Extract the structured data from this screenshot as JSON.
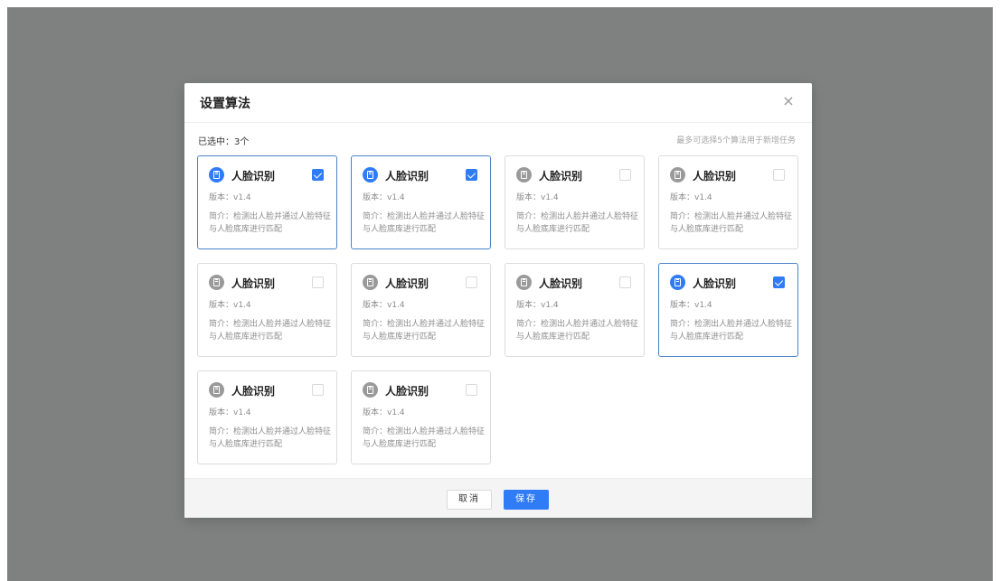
{
  "modal": {
    "title": "设置算法",
    "close": "×",
    "selected_count": "已选中：3个",
    "hint": "最多可选择5个算法用于新增任务"
  },
  "cards": [
    {
      "title": "人脸识别",
      "version": "版本：v1.4",
      "desc": "简介：检测出人脸并通过人脸特征与人脸底库进行匹配",
      "selected": true
    },
    {
      "title": "人脸识别",
      "version": "版本：v1.4",
      "desc": "简介：检测出人脸并通过人脸特征与人脸底库进行匹配",
      "selected": true
    },
    {
      "title": "人脸识别",
      "version": "版本：v1.4",
      "desc": "简介：检测出人脸并通过人脸特征与人脸底库进行匹配",
      "selected": false
    },
    {
      "title": "人脸识别",
      "version": "版本：v1.4",
      "desc": "简介：检测出人脸并通过人脸特征与人脸底库进行匹配",
      "selected": false
    },
    {
      "title": "人脸识别",
      "version": "版本：v1.4",
      "desc": "简介：检测出人脸并通过人脸特征与人脸底库进行匹配",
      "selected": false
    },
    {
      "title": "人脸识别",
      "version": "版本：v1.4",
      "desc": "简介：检测出人脸并通过人脸特征与人脸底库进行匹配",
      "selected": false
    },
    {
      "title": "人脸识别",
      "version": "版本：v1.4",
      "desc": "简介：检测出人脸并通过人脸特征与人脸底库进行匹配",
      "selected": false
    },
    {
      "title": "人脸识别",
      "version": "版本：v1.4",
      "desc": "简介：检测出人脸并通过人脸特征与人脸底库进行匹配",
      "selected": true
    },
    {
      "title": "人脸识别",
      "version": "版本：v1.4",
      "desc": "简介：检测出人脸并通过人脸特征与人脸底库进行匹配",
      "selected": false
    },
    {
      "title": "人脸识别",
      "version": "版本：v1.4",
      "desc": "简介：检测出人脸并通过人脸特征与人脸底库进行匹配",
      "selected": false
    }
  ],
  "footer": {
    "cancel_label": "取消",
    "save_label": "保存"
  },
  "colors": {
    "accent": "#2f7cf6",
    "overlay": "#7f8080",
    "selected_border": "#4a83c7"
  },
  "icons": {
    "card_icon": "document-icon",
    "check": "checkbox-icon",
    "close": "close-icon"
  }
}
